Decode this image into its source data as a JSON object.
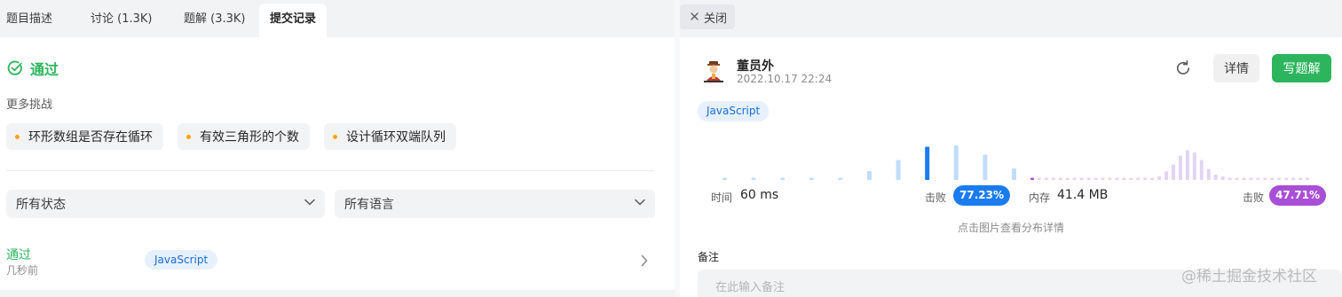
{
  "tabs": [
    {
      "label": "题目描述"
    },
    {
      "label": "讨论 (1.3K)"
    },
    {
      "label": "题解 (3.3K)"
    },
    {
      "label": "提交记录"
    }
  ],
  "result": {
    "status": "通过"
  },
  "more": {
    "title": "更多挑战",
    "items": [
      "环形数组是否存在循环",
      "有效三角形的个数",
      "设计循环双端队列"
    ]
  },
  "filters": {
    "status": "所有状态",
    "language": "所有语言"
  },
  "submission": {
    "status": "通过",
    "time": "几秒前",
    "language": "JavaScript"
  },
  "detail": {
    "close_label": "关闭",
    "user": "董员外",
    "date": "2022.10.17 22:24",
    "detail_button": "详情",
    "solution_button": "写题解",
    "language": "JavaScript",
    "time_label": "时间",
    "time_value": "60 ms",
    "beat_label": "击败",
    "time_beat": "77.23%",
    "memory_label": "内存",
    "memory_value": "41.4 MB",
    "memory_beat": "47.71%",
    "hint": "点击图片查看分布详情",
    "remark_label": "备注",
    "remark_placeholder": "在此输入备注",
    "watermark": "@稀土掘金技术社区"
  },
  "colors": {
    "accepted": "#2db55d",
    "time_bar": "#c2dcfa",
    "time_bar_current": "#1a7cf0",
    "time_badge": "#1a7cf0",
    "memory_bar": "#e2d4f4",
    "memory_bar_current": "#a84fd6",
    "memory_badge": "#a84fd6",
    "chip_dot": "#ffa116"
  },
  "time_distribution": [
    0.05,
    0.05,
    0.05,
    0.05,
    0.05,
    0.2,
    0.45,
    0.75,
    0.78,
    0.57,
    0.26
  ],
  "time_current_index": 7,
  "memory_distribution": [
    0.05,
    0.05,
    0.05,
    0.05,
    0.05,
    0.05,
    0.05,
    0.05,
    0.05,
    0.05,
    0.05,
    0.05,
    0.05,
    0.05,
    0.05,
    0.05,
    0.05,
    0.05,
    0.08,
    0.2,
    0.35,
    0.55,
    0.67,
    0.62,
    0.45,
    0.25,
    0.12,
    0.08,
    0.05,
    0.05,
    0.05,
    0.05,
    0.05,
    0.05,
    0.05,
    0.05,
    0.05,
    0.05,
    0.05,
    0.05
  ],
  "memory_current_index": 0
}
